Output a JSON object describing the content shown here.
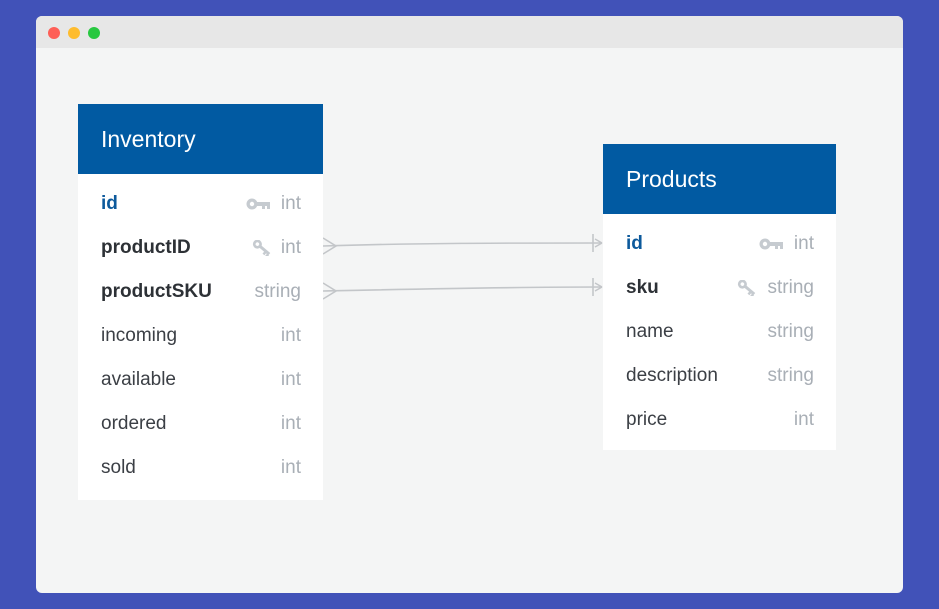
{
  "tables": [
    {
      "name": "Inventory",
      "fields": [
        {
          "name": "id",
          "type": "int",
          "key": "pk",
          "icon": "primary-key-icon"
        },
        {
          "name": "productID",
          "type": "int",
          "key": "fk",
          "icon": "foreign-key-icon"
        },
        {
          "name": "productSKU",
          "type": "string",
          "key": "fk",
          "icon": ""
        },
        {
          "name": "incoming",
          "type": "int",
          "key": "",
          "icon": ""
        },
        {
          "name": "available",
          "type": "int",
          "key": "",
          "icon": ""
        },
        {
          "name": "ordered",
          "type": "int",
          "key": "",
          "icon": ""
        },
        {
          "name": "sold",
          "type": "int",
          "key": "",
          "icon": ""
        }
      ]
    },
    {
      "name": "Products",
      "fields": [
        {
          "name": "id",
          "type": "int",
          "key": "pk",
          "icon": "primary-key-icon"
        },
        {
          "name": "sku",
          "type": "string",
          "key": "fk",
          "icon": "foreign-key-icon"
        },
        {
          "name": "name",
          "type": "string",
          "key": "",
          "icon": ""
        },
        {
          "name": "description",
          "type": "string",
          "key": "",
          "icon": ""
        },
        {
          "name": "price",
          "type": "int",
          "key": "",
          "icon": ""
        }
      ]
    }
  ],
  "relations": [
    {
      "from": "Inventory.productID",
      "to": "Products.id",
      "from_end": "many",
      "to_end": "one"
    },
    {
      "from": "Inventory.productSKU",
      "to": "Products.sku",
      "from_end": "many",
      "to_end": "one"
    }
  ],
  "colors": {
    "header": "#015aa2",
    "background": "#4152b8",
    "canvas": "#f4f5f5",
    "line": "#c3c6c9"
  }
}
